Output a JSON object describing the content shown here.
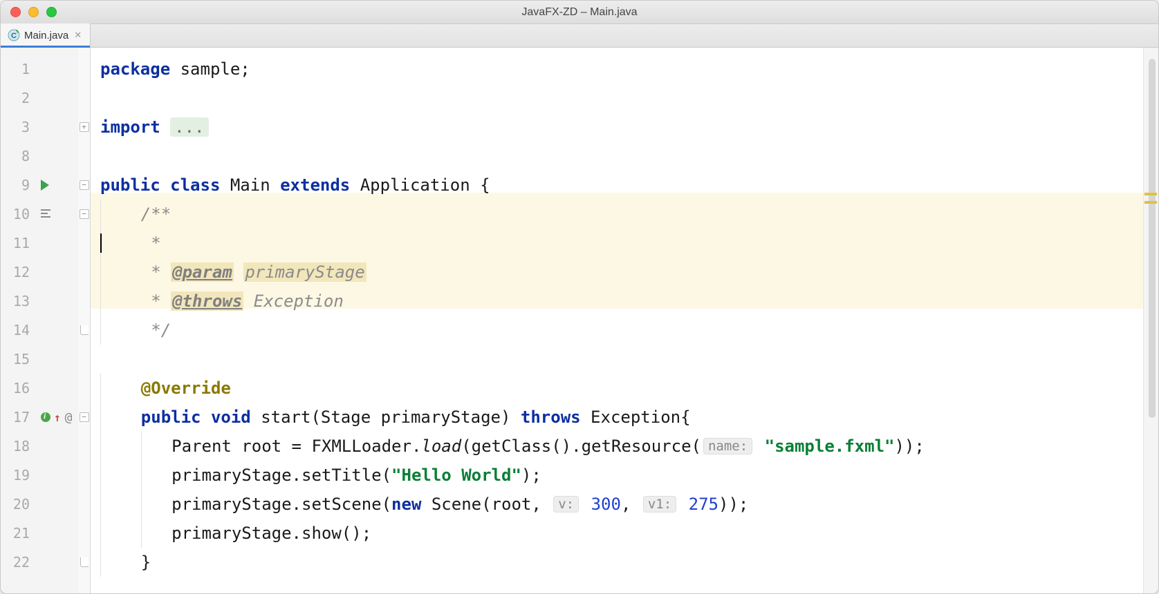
{
  "window": {
    "title": "JavaFX-ZD – Main.java"
  },
  "tab": {
    "filename": "Main.java"
  },
  "lineNumbers": [
    "1",
    "2",
    "3",
    "8",
    "9",
    "10",
    "11",
    "12",
    "13",
    "14",
    "15",
    "16",
    "17",
    "18",
    "19",
    "20",
    "21",
    "22"
  ],
  "code": {
    "l1": {
      "package_kw": "package",
      "pkg": " sample;"
    },
    "l3": {
      "import_kw": "import",
      "fold_ph": "..."
    },
    "l9": {
      "public_kw": "public",
      "class_kw": "class",
      "main": " Main ",
      "extends_kw": "extends",
      "app": " Application {"
    },
    "doc": {
      "open": "/**",
      "caret_line": " * ",
      "param_tag": "@param",
      "param_name": "primaryStage",
      "throws_tag": "@throws",
      "throws_name": "Exception",
      "close": "*/"
    },
    "override": "@Override",
    "l17": {
      "public_kw": "public",
      "void_kw": "void",
      "sig": " start(Stage primaryStage) ",
      "throws_kw": "throws",
      "exc": " Exception{"
    },
    "l18": {
      "pre": "Parent root = FXMLLoader.",
      "load": "load",
      "mid": "(getClass().getResource(",
      "hint": "name:",
      "str": "\"sample.fxml\"",
      "post": "));"
    },
    "l19": {
      "pre": "primaryStage.setTitle(",
      "str": "\"Hello World\"",
      "post": ");"
    },
    "l20": {
      "pre": "primaryStage.setScene(",
      "new_kw": "new",
      "mid": " Scene(root, ",
      "h1": "v:",
      "n1": "300",
      "comma": ", ",
      "h2": "v1:",
      "n2": "275",
      "post": "));"
    },
    "l21": "primaryStage.show();",
    "l22": "}"
  }
}
